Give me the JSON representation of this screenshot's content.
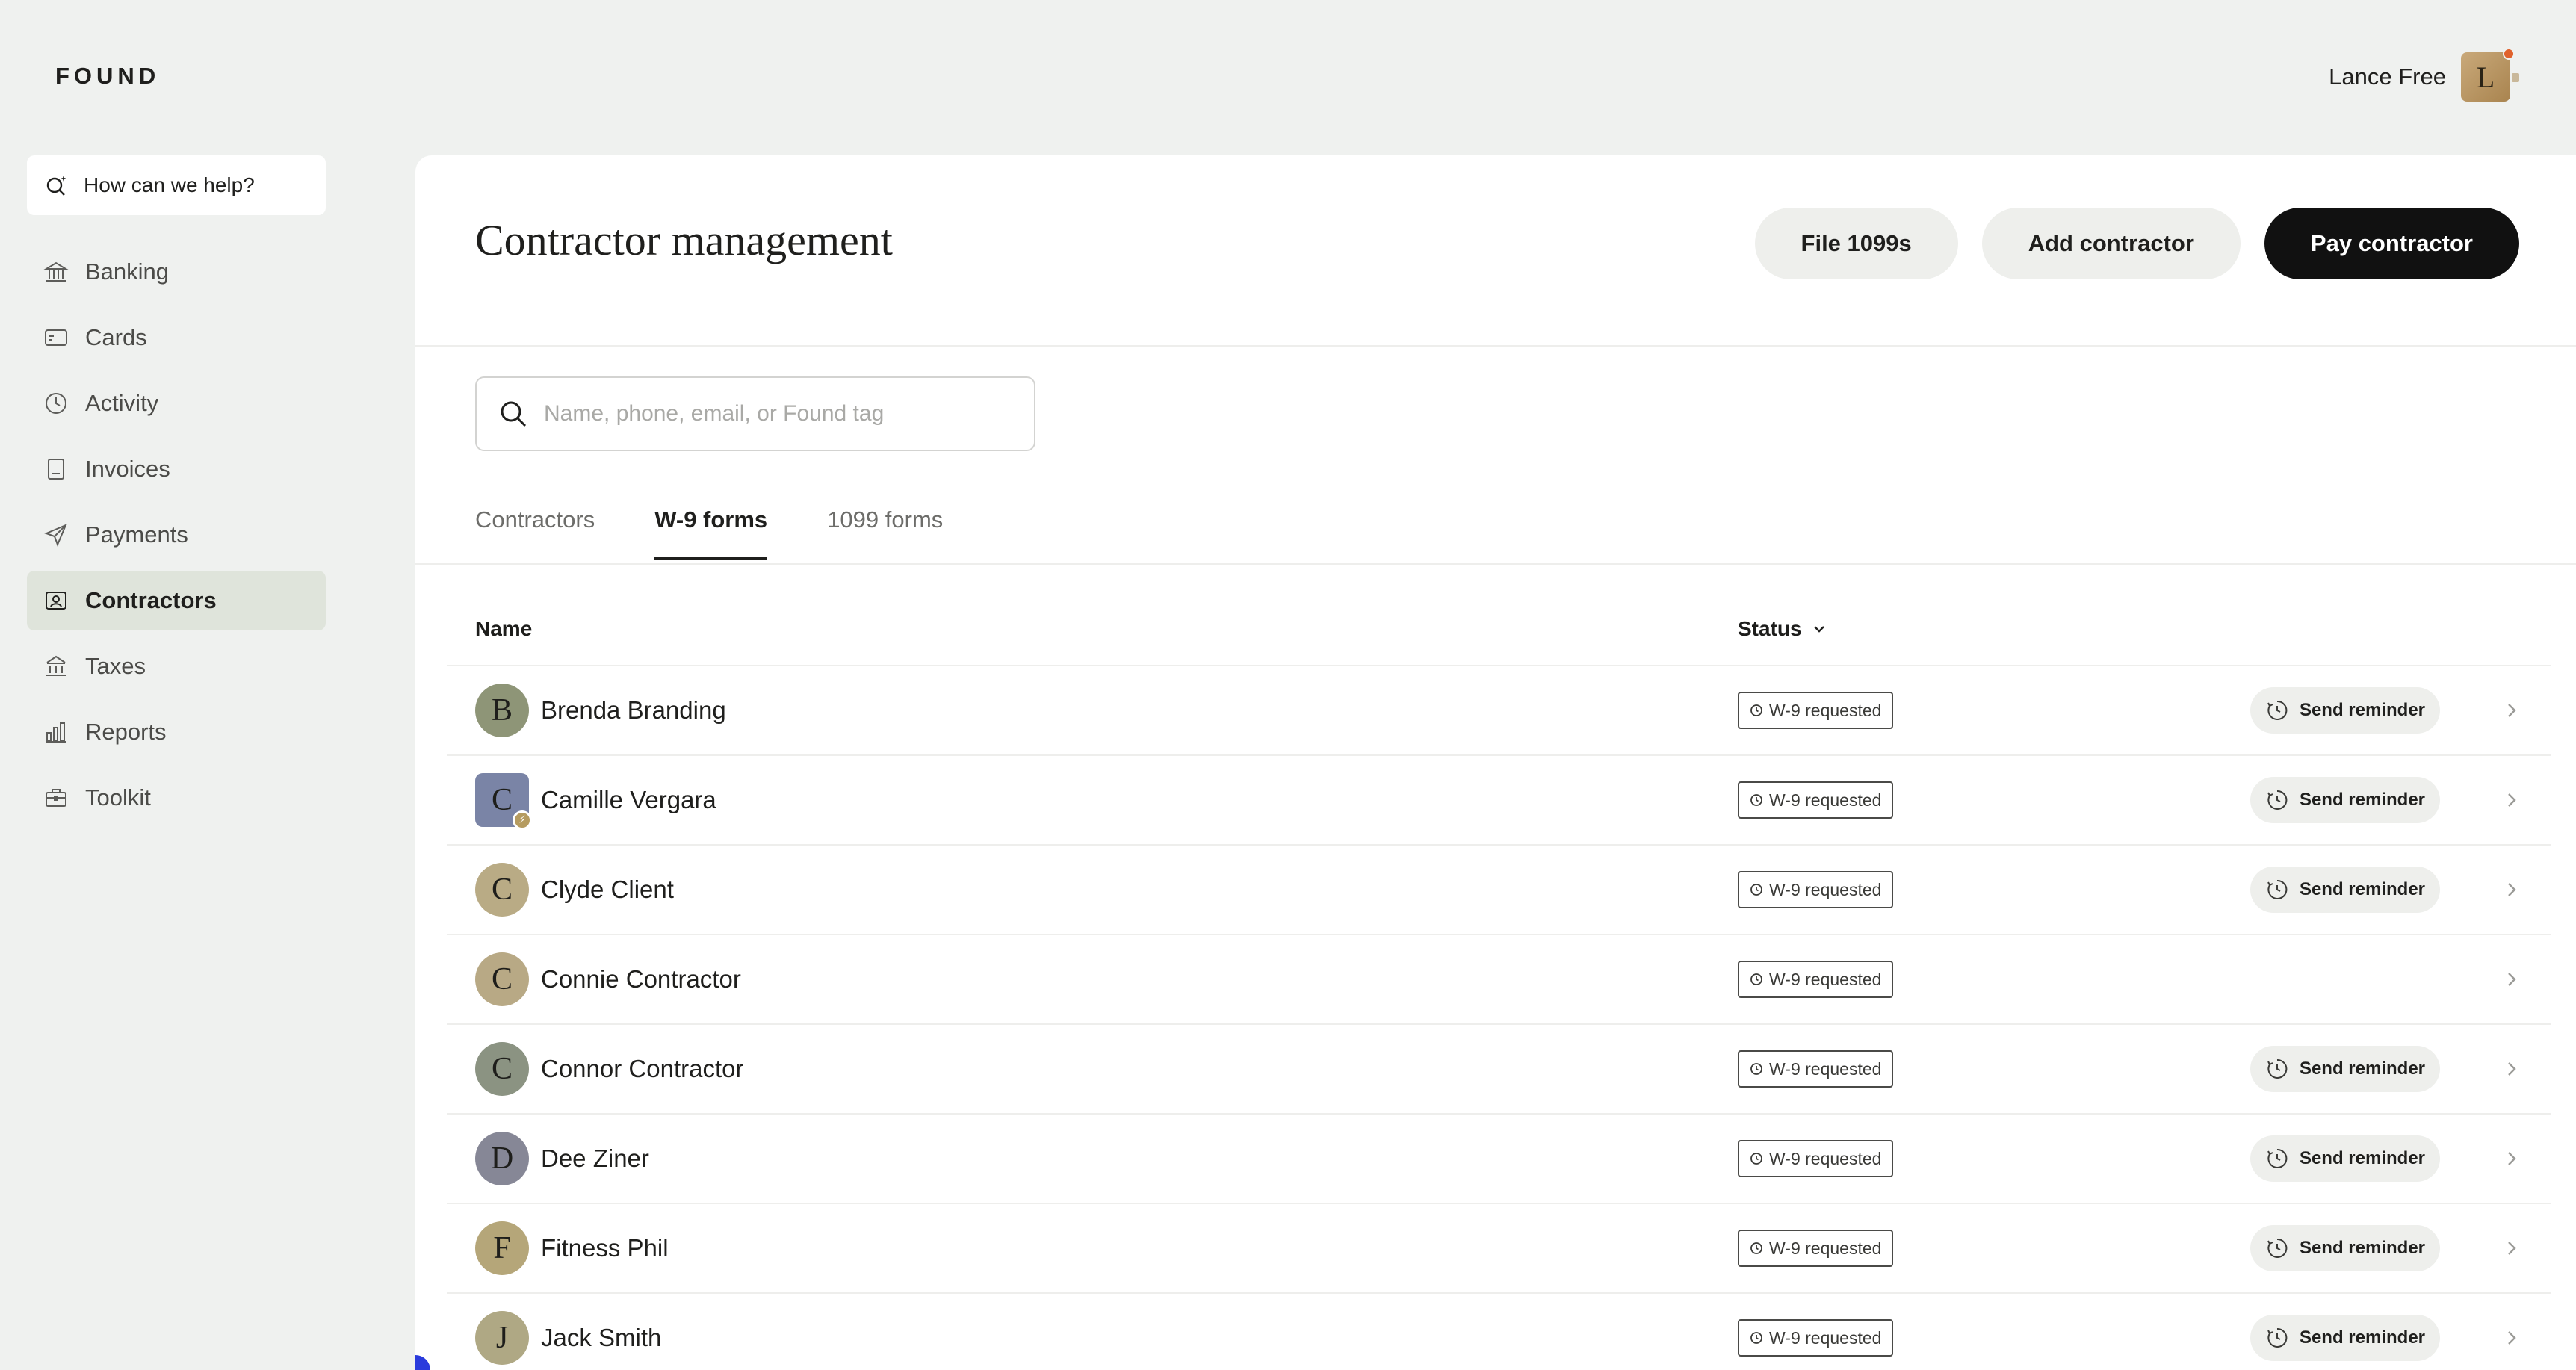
{
  "app": {
    "logo": "FOUND"
  },
  "user": {
    "name": "Lance Free",
    "initial": "L"
  },
  "sidebar": {
    "help": "How can we help?",
    "items": [
      {
        "label": "Banking",
        "icon": "bank-icon"
      },
      {
        "label": "Cards",
        "icon": "card-icon"
      },
      {
        "label": "Activity",
        "icon": "clock-icon"
      },
      {
        "label": "Invoices",
        "icon": "invoice-icon"
      },
      {
        "label": "Payments",
        "icon": "send-icon"
      },
      {
        "label": "Contractors",
        "icon": "contractor-icon",
        "active": true
      },
      {
        "label": "Taxes",
        "icon": "building-icon"
      },
      {
        "label": "Reports",
        "icon": "bar-chart-icon"
      },
      {
        "label": "Toolkit",
        "icon": "briefcase-icon"
      }
    ]
  },
  "page": {
    "title": "Contractor management",
    "actions": {
      "file": "File 1099s",
      "add": "Add contractor",
      "pay": "Pay contractor"
    },
    "search_placeholder": "Name, phone, email, or Found tag",
    "tabs": [
      "Contractors",
      "W-9 forms",
      "1099 forms"
    ],
    "active_tab": "W-9 forms",
    "columns": {
      "name": "Name",
      "status": "Status"
    },
    "reminder_label": "Send reminder",
    "rows": [
      {
        "initial": "B",
        "name": "Brenda Branding",
        "status": "W-9 requested",
        "reminder": true,
        "color": "#8e9577"
      },
      {
        "initial": "C",
        "name": "Camille Vergara",
        "status": "W-9 requested",
        "reminder": true,
        "color": "#7a84a6",
        "badge": true
      },
      {
        "initial": "C",
        "name": "Clyde Client",
        "status": "W-9 requested",
        "reminder": true,
        "color": "#b9ab85"
      },
      {
        "initial": "C",
        "name": "Connie Contractor",
        "status": "W-9 requested",
        "reminder": false,
        "color": "#b8a985"
      },
      {
        "initial": "C",
        "name": "Connor Contractor",
        "status": "W-9 requested",
        "reminder": true,
        "color": "#8b9382"
      },
      {
        "initial": "D",
        "name": "Dee Ziner",
        "status": "W-9 requested",
        "reminder": true,
        "color": "#868796"
      },
      {
        "initial": "F",
        "name": "Fitness Phil",
        "status": "W-9 requested",
        "reminder": true,
        "color": "#b5a679"
      },
      {
        "initial": "J",
        "name": "Jack Smith",
        "status": "W-9 requested",
        "reminder": true,
        "color": "#afa884"
      }
    ]
  }
}
